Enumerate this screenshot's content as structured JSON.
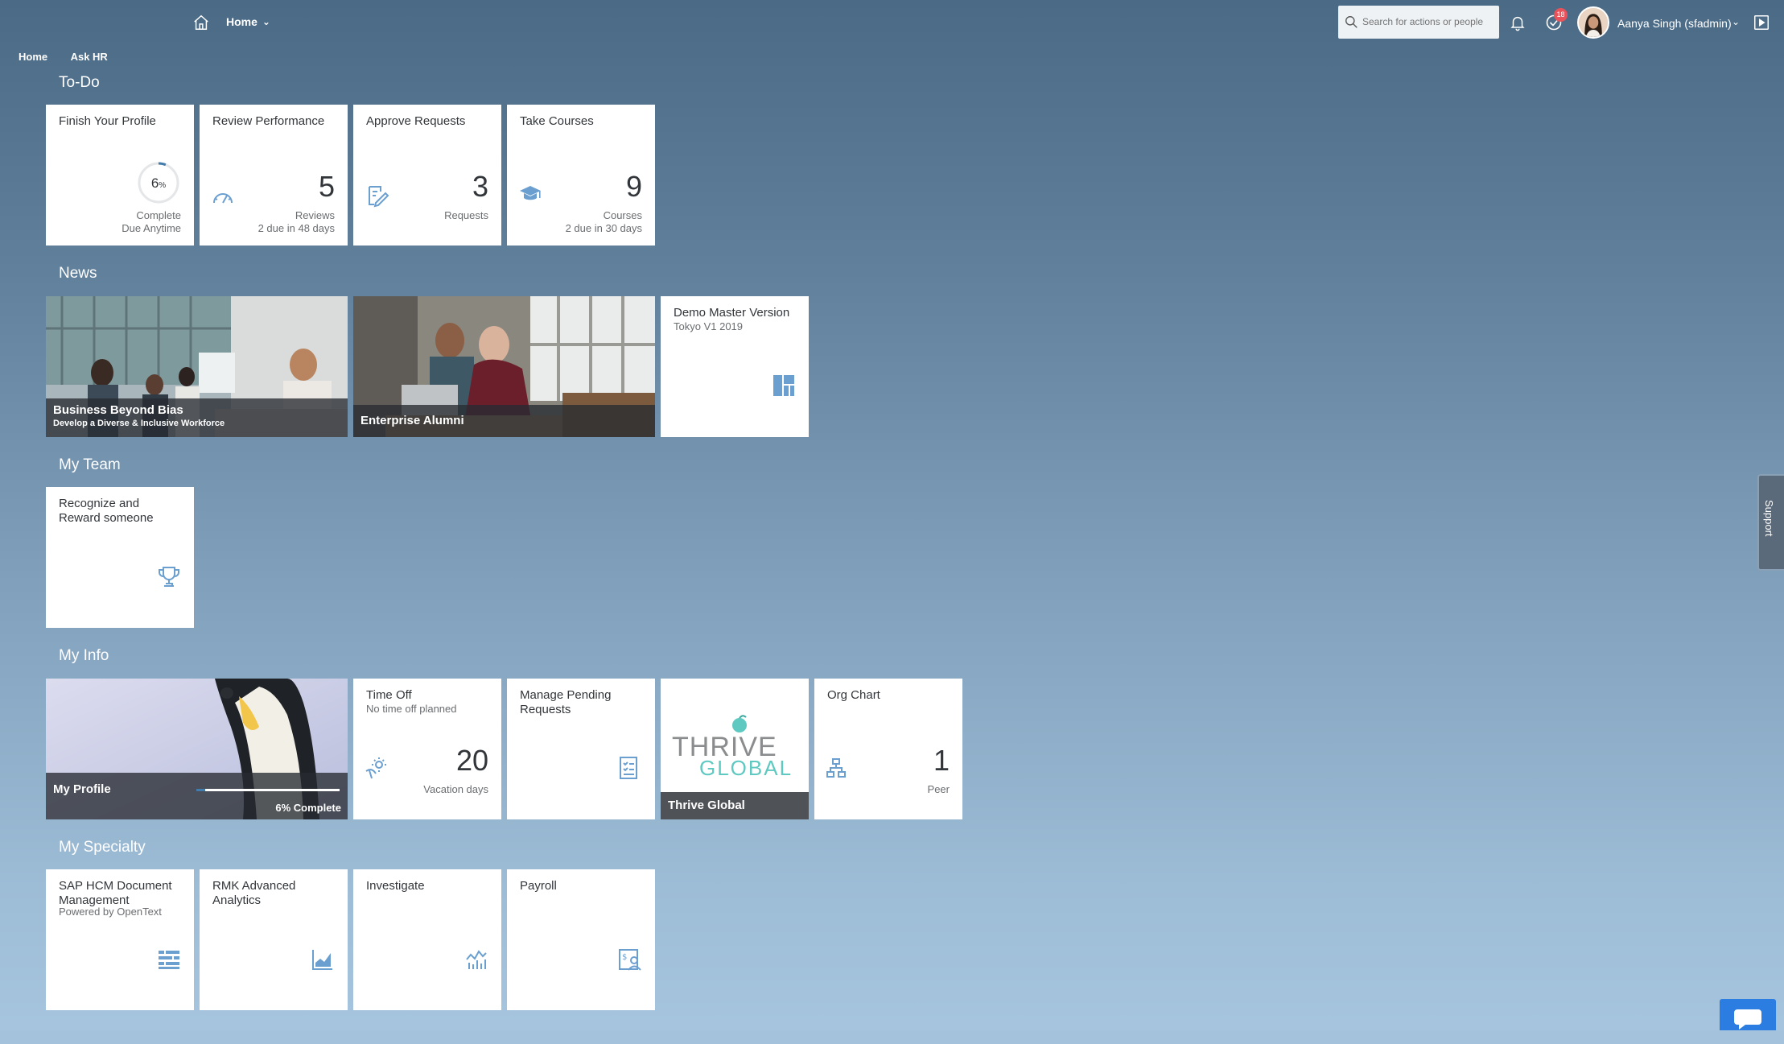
{
  "shell": {
    "home_menu_label": "Home",
    "search_placeholder": "Search for actions or people",
    "notification_badge": "18",
    "user_name": "Aanya Singh (sfadmin)"
  },
  "nav": {
    "items": [
      "Home",
      "Ask HR"
    ]
  },
  "sections": {
    "todo": "To-Do",
    "news": "News",
    "myteam": "My Team",
    "myinfo": "My Info",
    "myspecialty": "My Specialty"
  },
  "todo": {
    "profile": {
      "title": "Finish Your Profile",
      "percent": "6",
      "percent_sign": "%",
      "percent_value": 0.06,
      "label1": "Complete",
      "label2": "Due Anytime"
    },
    "performance": {
      "title": "Review Performance",
      "value": "5",
      "unit": "Reviews",
      "foot": "2 due in 48 days"
    },
    "approve": {
      "title": "Approve Requests",
      "value": "3",
      "unit": "Requests"
    },
    "courses": {
      "title": "Take Courses",
      "value": "9",
      "unit": "Courses",
      "foot": "2 due in 30 days"
    }
  },
  "news": {
    "bias": {
      "title": "Business Beyond Bias",
      "subtitle": "Develop a Diverse & Inclusive Workforce"
    },
    "alumni": {
      "title": "Enterprise Alumni"
    },
    "demo": {
      "title": "Demo Master Version",
      "subtitle": "Tokyo V1 2019"
    }
  },
  "myteam": {
    "recognize": {
      "title": "Recognize and Reward someone"
    }
  },
  "myinfo": {
    "profile": {
      "title": "My Profile",
      "progress_label": "6% Complete",
      "progress_value": 0.06
    },
    "timeoff": {
      "title": "Time Off",
      "subtitle": "No time off planned",
      "value": "20",
      "unit": "Vacation days"
    },
    "pending": {
      "title": "Manage Pending Requests"
    },
    "thrive": {
      "title": "Thrive Global",
      "logo_line1": "THRIVE",
      "logo_line2": "GLOBAL"
    },
    "orgchart": {
      "title": "Org Chart",
      "value": "1",
      "unit": "Peer"
    }
  },
  "specialty": {
    "hcm": {
      "title": "SAP HCM Document Management",
      "subtitle": "Powered by OpenText"
    },
    "rmk": {
      "title": "RMK Advanced Analytics"
    },
    "investigate": {
      "title": "Investigate"
    },
    "payroll": {
      "title": "Payroll"
    }
  },
  "support_label": "Support",
  "colors": {
    "icon_blue": "#6a9fd0",
    "badge_red": "#e8525a",
    "chat_blue": "#2b7de1"
  }
}
